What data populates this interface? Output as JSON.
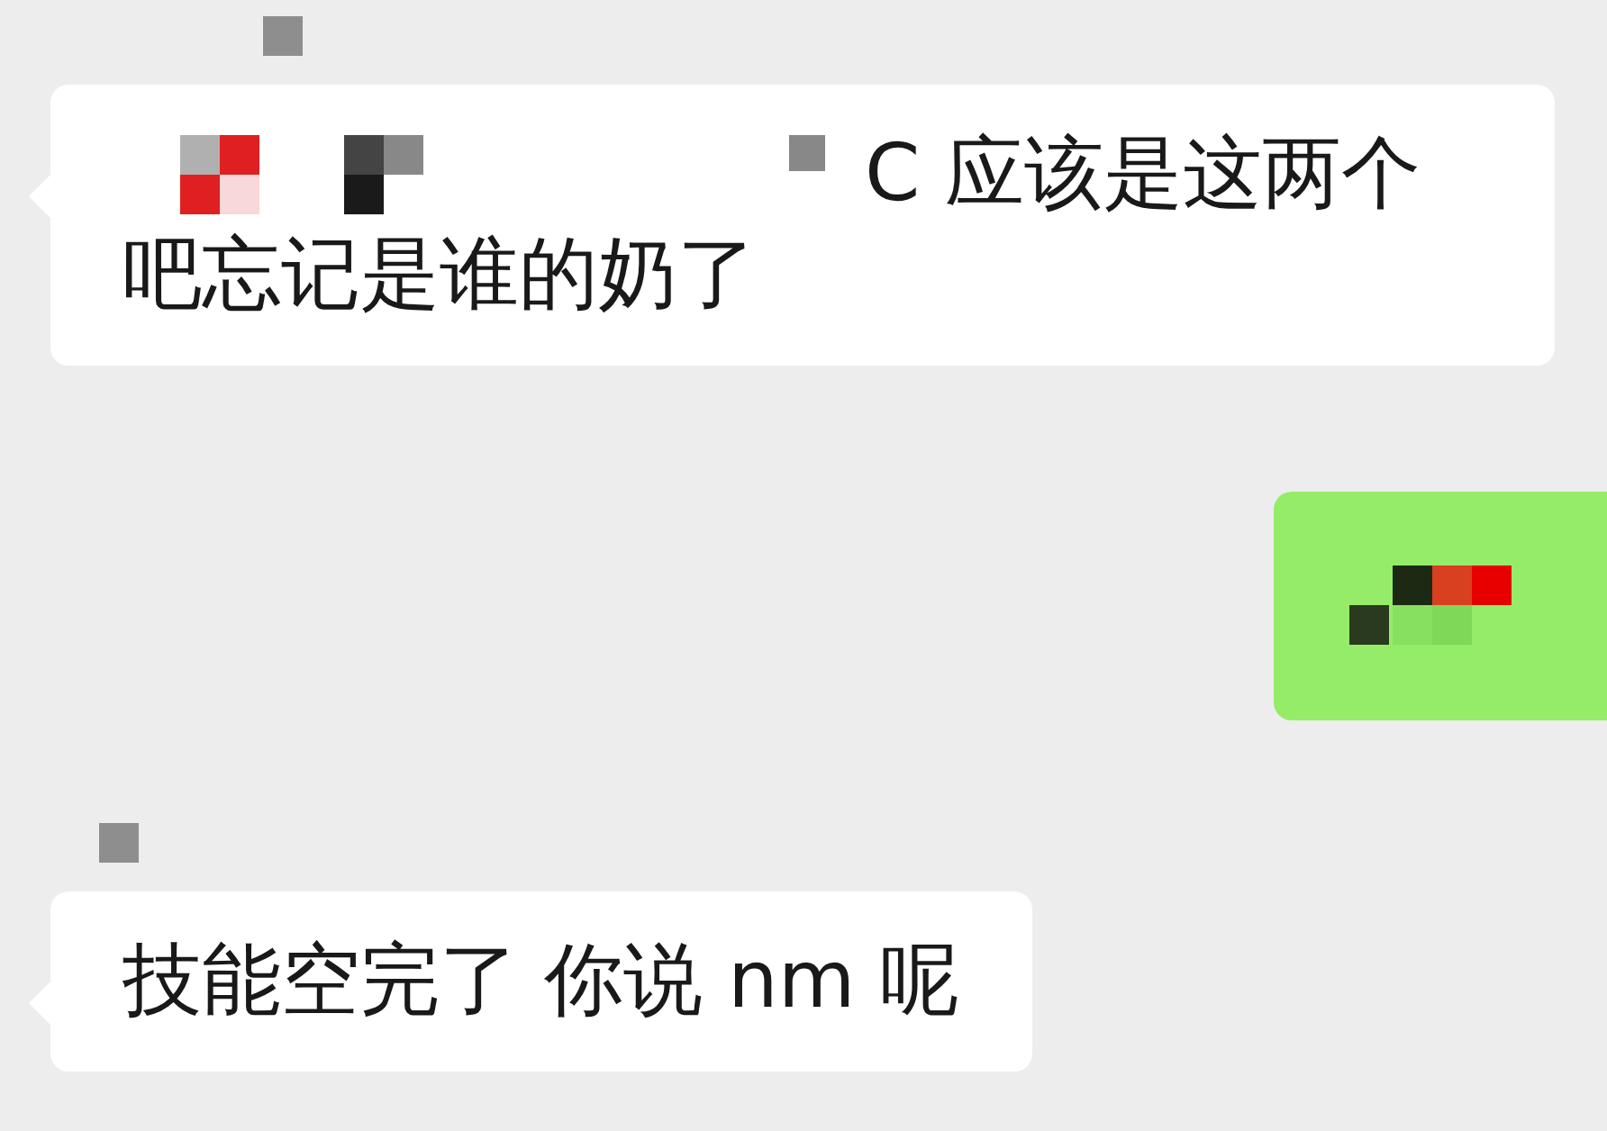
{
  "messages": [
    {
      "kind": "received",
      "lines": [
        "C 应该是这两个",
        "吧忘记是谁的奶了"
      ],
      "redacted_prefix": true
    },
    {
      "kind": "sent"
    },
    {
      "kind": "received",
      "lines": [
        "技能空完了  你说 nm 呢"
      ],
      "redacted_prefix": false
    }
  ]
}
